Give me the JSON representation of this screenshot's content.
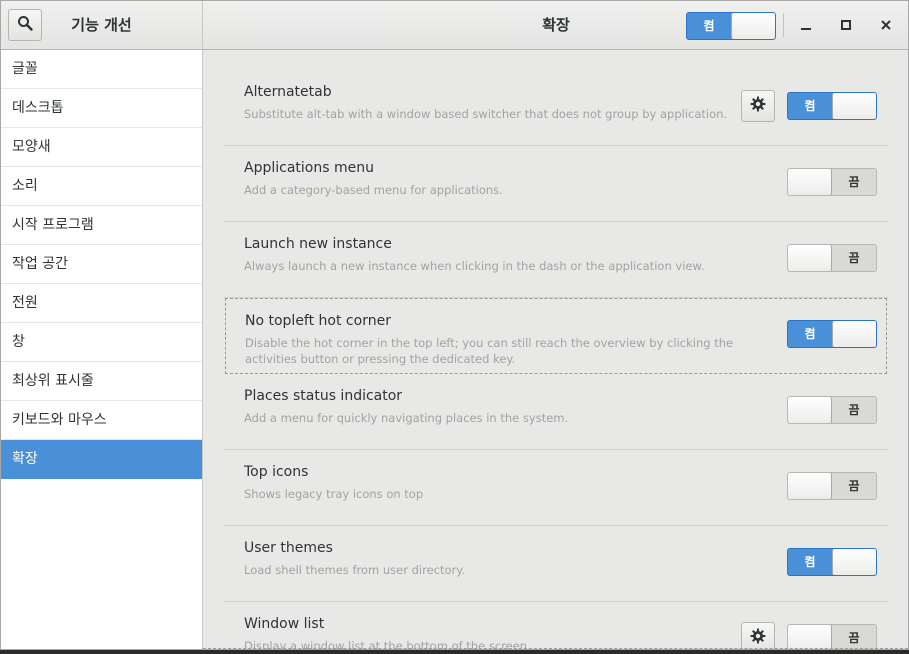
{
  "header": {
    "left_title": "기능 개선",
    "center_title": "확장",
    "master_switch": {
      "label": "켬",
      "state": "on"
    }
  },
  "icons": {
    "search": "search-icon",
    "minimize": "minimize-icon",
    "maximize": "maximize-icon",
    "close": "close-icon",
    "settings": "gear-icon"
  },
  "colors": {
    "accent": "#4a90d9",
    "sidebar_bg": "#ffffff",
    "content_bg": "#e8e8e7",
    "desc_text": "#a0a3a1"
  },
  "sidebar": {
    "items": [
      {
        "label": "글꼴"
      },
      {
        "label": "데스크톱"
      },
      {
        "label": "모양새"
      },
      {
        "label": "소리"
      },
      {
        "label": "시작 프로그램"
      },
      {
        "label": "작업 공간"
      },
      {
        "label": "전원"
      },
      {
        "label": "창"
      },
      {
        "label": "최상위 표시줄"
      },
      {
        "label": "키보드와 마우스"
      },
      {
        "label": "확장",
        "selected": true
      }
    ]
  },
  "switch_labels": {
    "on": "켬",
    "off": "끔"
  },
  "extensions": [
    {
      "name": "Alternatetab",
      "description": "Substitute alt-tab with a window based switcher that does not group by application.",
      "enabled": true,
      "has_settings": true
    },
    {
      "name": "Applications menu",
      "description": "Add a category-based menu for applications.",
      "enabled": false,
      "has_settings": false
    },
    {
      "name": "Launch new instance",
      "description": "Always launch a new instance when clicking in the dash or the application view.",
      "enabled": false,
      "has_settings": false
    },
    {
      "name": "No topleft hot corner",
      "description": "Disable the hot corner in the top left; you can still reach the overview by clicking the activities button or pressing the dedicated key.",
      "enabled": true,
      "has_settings": false,
      "focused": true
    },
    {
      "name": "Places status indicator",
      "description": "Add a menu for quickly navigating places in the system.",
      "enabled": false,
      "has_settings": false
    },
    {
      "name": "Top icons",
      "description": "Shows legacy tray icons on top",
      "enabled": false,
      "has_settings": false
    },
    {
      "name": "User themes",
      "description": "Load shell themes from user directory.",
      "enabled": true,
      "has_settings": false
    },
    {
      "name": "Window list",
      "description": "Display a window list at the bottom of the screen.",
      "enabled": false,
      "has_settings": true
    }
  ]
}
